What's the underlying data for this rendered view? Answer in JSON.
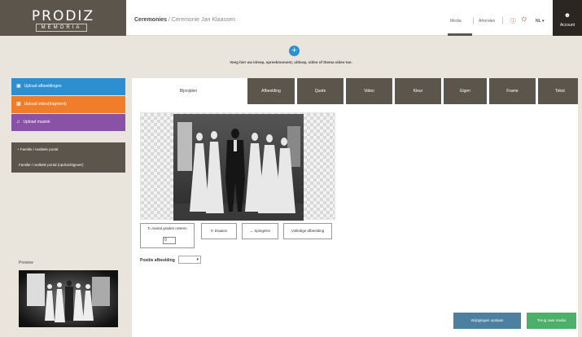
{
  "logo": {
    "title": "PRODIZ",
    "subtitle": "MEMORIA"
  },
  "breadcrumb": {
    "root": "Ceremonies",
    "separator": " / ",
    "current": "Ceremonie Jan Klaassen"
  },
  "top_nav": {
    "media": "Media",
    "afronden": "Afronden",
    "language": "NL ▾"
  },
  "account": {
    "label": "Account"
  },
  "upload": {
    "plus": "+",
    "hint": "Voeg hier uw inleep, spreekmoment, uitloop, video of thema video toe."
  },
  "sidebar": {
    "upload_images": "Upload afbeeldingen",
    "upload_video": "Upload video(fragment)",
    "upload_music": "Upload muziek",
    "portal_1": "+ Familie / realtiele portal",
    "portal_2": "Familie / realtiele portal (opdrachtgever)",
    "preview_label": "Preview"
  },
  "tabs": [
    "Bijsnijden",
    "Afbeelding",
    "Quote",
    "Video",
    "Kleur",
    "Eigen",
    "Frame",
    "Tekst"
  ],
  "editor": {
    "resize_label": "Aantal graden roteren",
    "resize_value": "0",
    "rotate_label": "Draaien",
    "mirror_label": "↔ Spiegelen",
    "full_label": "Volledige afbeelding",
    "position_label": "Positie afbeelding",
    "position_value": "▾"
  },
  "footer": {
    "save": "Wijzigingen opslaan",
    "back": "Terug naar media"
  },
  "colors": {
    "brand_brown": "#5c554c",
    "blue": "#2e8fd0",
    "orange": "#ef7d2a",
    "purple": "#8a52a6",
    "save": "#4c7fa0",
    "back": "#4caf6a"
  }
}
